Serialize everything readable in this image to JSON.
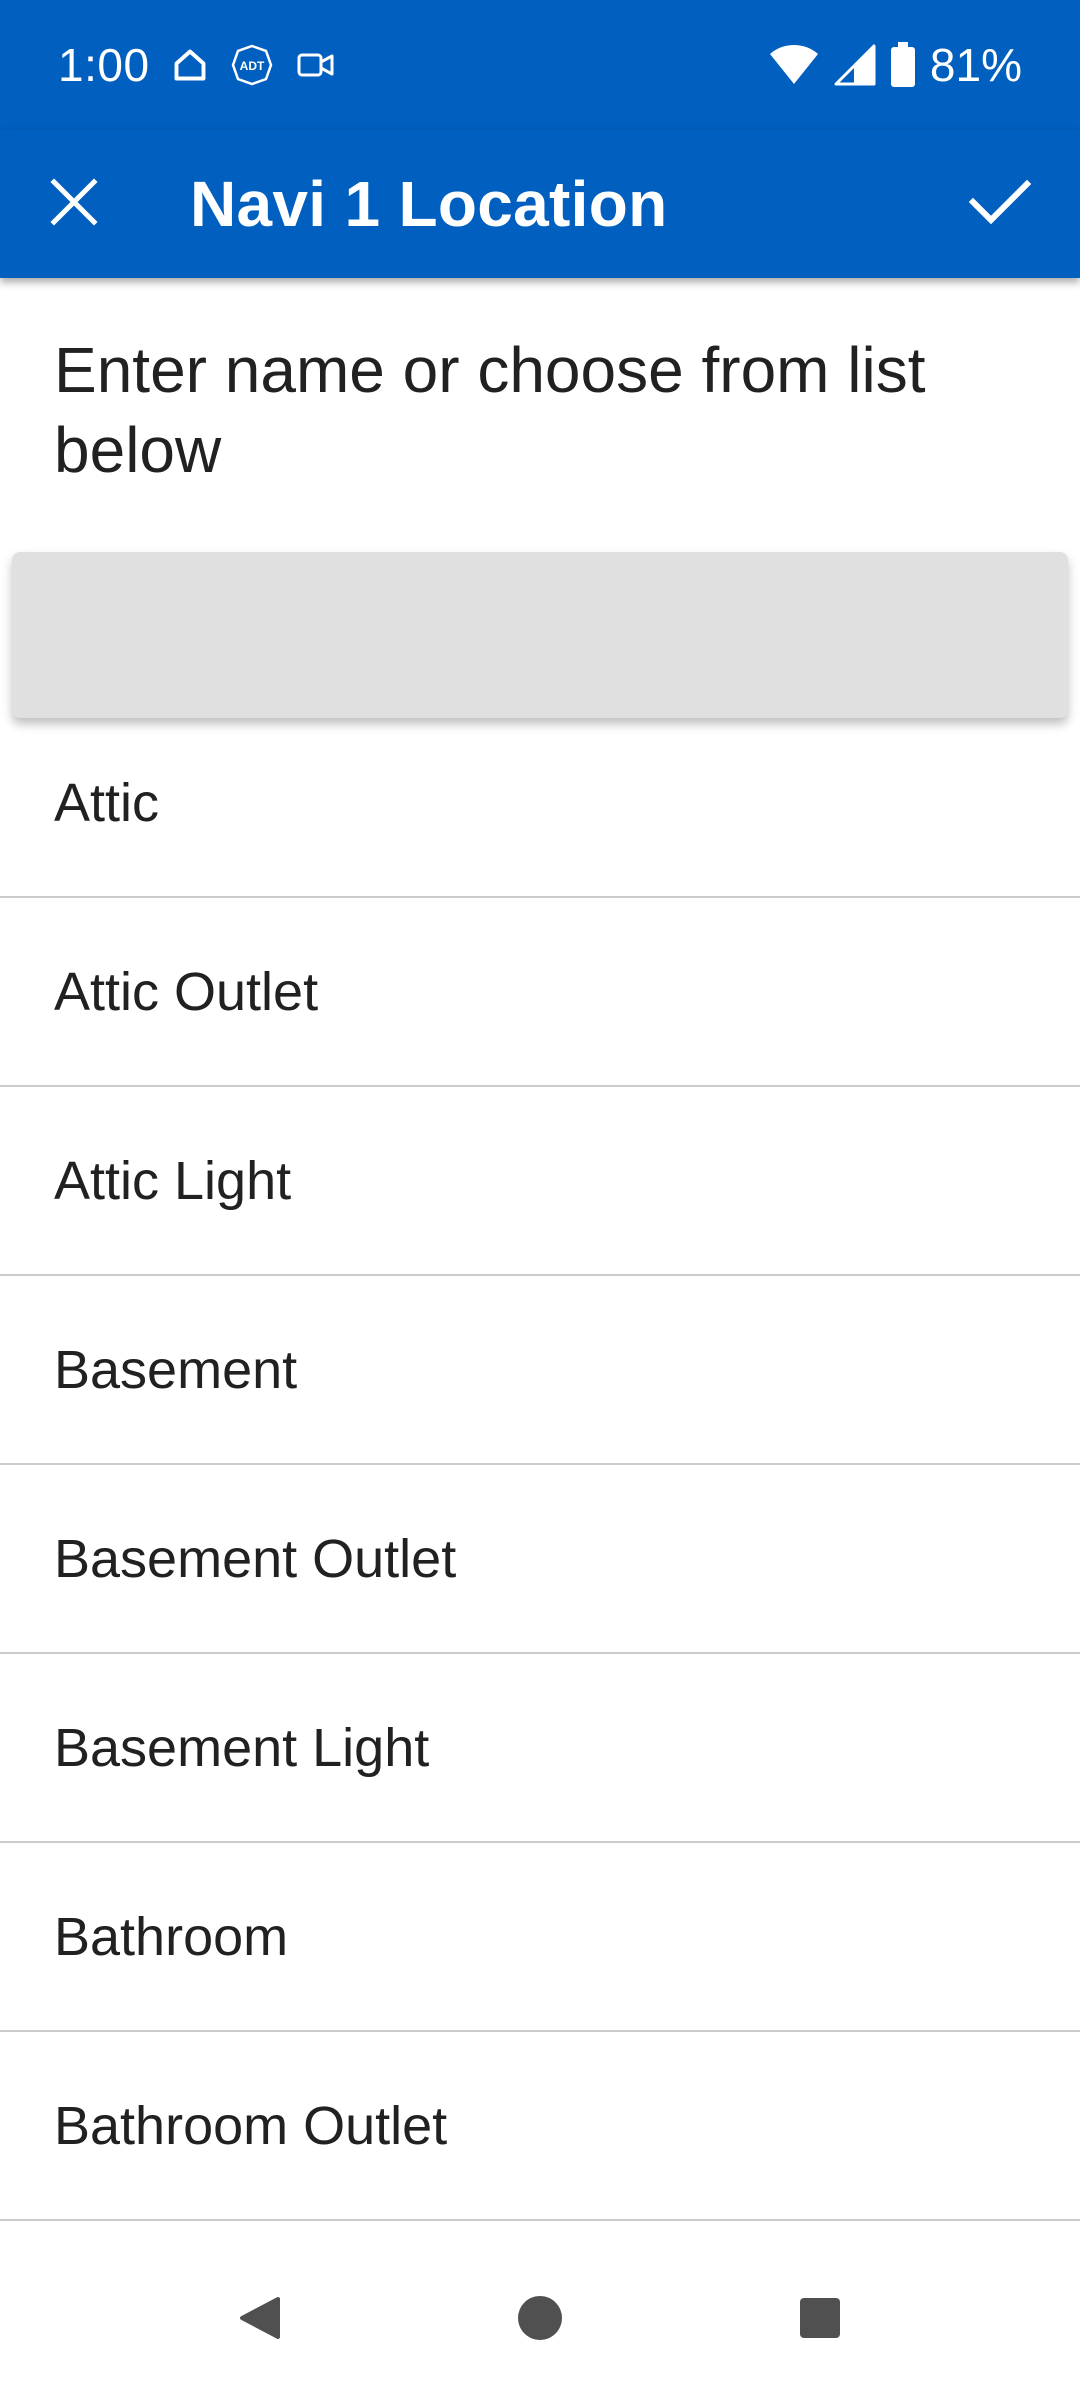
{
  "status_bar": {
    "time": "1:00",
    "battery_percent": "81%",
    "icons": [
      "home-icon",
      "adt-icon",
      "video-camera-icon",
      "wifi-icon",
      "signal-icon",
      "battery-icon"
    ]
  },
  "app_bar": {
    "title": "Navi 1 Location",
    "close_icon": "close-icon",
    "confirm_icon": "check-icon",
    "background_color": "#005fbf"
  },
  "instruction": "Enter name or choose from list below",
  "name_input": {
    "value": "",
    "placeholder": ""
  },
  "locations": [
    {
      "label": "Attic"
    },
    {
      "label": "Attic Outlet"
    },
    {
      "label": "Attic Light"
    },
    {
      "label": "Basement"
    },
    {
      "label": "Basement Outlet"
    },
    {
      "label": "Basement Light"
    },
    {
      "label": "Bathroom"
    },
    {
      "label": "Bathroom Outlet"
    }
  ],
  "nav_bar": {
    "buttons": [
      "back-icon",
      "home-icon",
      "recents-icon"
    ]
  }
}
